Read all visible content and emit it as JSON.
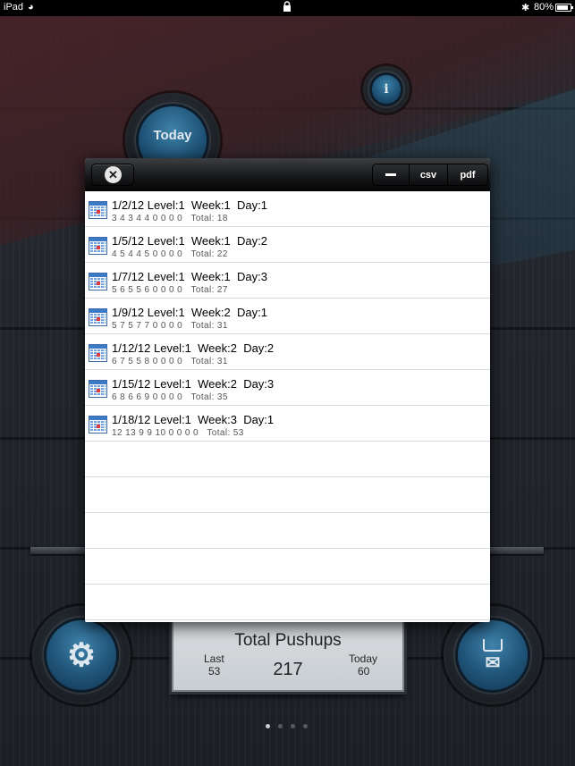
{
  "status_bar": {
    "carrier": "iPad",
    "battery": "80%"
  },
  "home": {
    "today_button": "Today",
    "info_button": "i",
    "totals": {
      "title": "Total Pushups",
      "last_label": "Last",
      "last_value": "53",
      "total_value": "217",
      "today_label": "Today",
      "today_value": "60"
    },
    "page_dots": 4,
    "active_page": 0
  },
  "history_modal": {
    "toolbar": {
      "close_icon": "close-circle-icon",
      "csv_label": "csv",
      "pdf_label": "pdf"
    },
    "entries": [
      {
        "title": "1/2/12 Level:1  Week:1  Day:1",
        "reps": "3 4 3 4 4 0 0 0 0",
        "total": "Total: 18"
      },
      {
        "title": "1/5/12 Level:1  Week:1  Day:2",
        "reps": "4 5 4 4 5 0 0 0 0",
        "total": "Total: 22"
      },
      {
        "title": "1/7/12 Level:1  Week:1  Day:3",
        "reps": "5 6 5 5 6 0 0 0 0",
        "total": "Total: 27"
      },
      {
        "title": "1/9/12 Level:1  Week:2  Day:1",
        "reps": "5 7 5 7 7 0 0 0 0",
        "total": "Total: 31"
      },
      {
        "title": "1/12/12 Level:1  Week:2  Day:2",
        "reps": "6 7 5 5 8 0 0 0 0",
        "total": "Total: 31"
      },
      {
        "title": "1/15/12 Level:1  Week:2  Day:3",
        "reps": "6 8 6 6 9 0 0 0 0",
        "total": "Total: 35"
      },
      {
        "title": "1/18/12 Level:1  Week:3  Day:1",
        "reps": "12 13 9 9 10 0 0 0 0",
        "total": "Total: 53"
      }
    ],
    "empty_rows": 5
  }
}
